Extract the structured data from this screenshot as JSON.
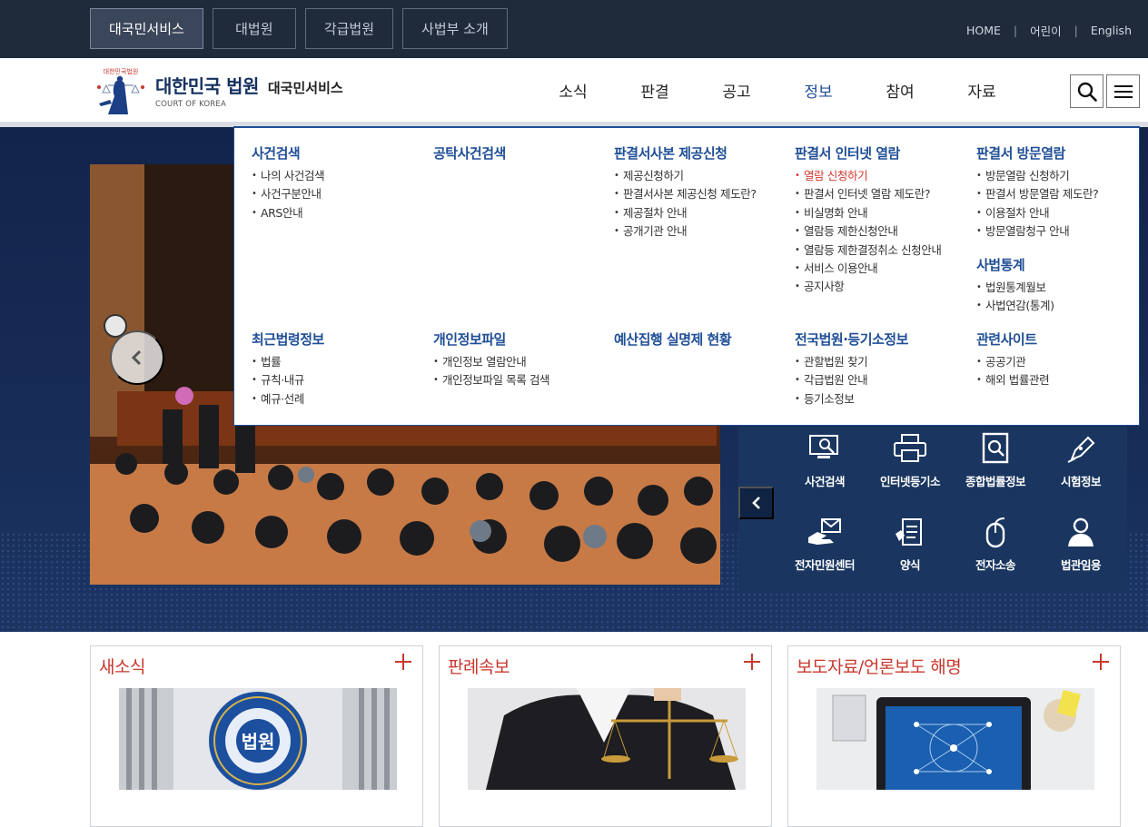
{
  "top_tabs": [
    {
      "label": "대국민서비스",
      "active": true
    },
    {
      "label": "대법원"
    },
    {
      "label": "각급법원"
    },
    {
      "label": "사법부 소개"
    }
  ],
  "utility_links": [
    "HOME",
    "어린이",
    "English"
  ],
  "logo": {
    "title": "대한민국 법원",
    "subtitle": "대국민서비스",
    "english": "COURT OF KOREA",
    "emblem_text": "대한민국법원"
  },
  "gnb": [
    {
      "label": "소식"
    },
    {
      "label": "판결"
    },
    {
      "label": "공고"
    },
    {
      "label": "정보",
      "active": true
    },
    {
      "label": "참여"
    },
    {
      "label": "자료"
    }
  ],
  "header_buttons": {
    "search_icon": "search-icon",
    "menu_icon": "hamburger-menu-icon"
  },
  "mega_menu": {
    "sections": [
      {
        "title": "사건검색",
        "items": [
          "나의 사건검색",
          "사건구분안내",
          "ARS안내"
        ]
      },
      {
        "title": "공탁사건검색",
        "items": []
      },
      {
        "title": "판결서사본 제공신청",
        "items": [
          "제공신청하기",
          "판결서사본 제공신청 제도란?",
          "제공절차 안내",
          "공개기관 안내"
        ]
      },
      {
        "title": "판결서 인터넷 열람",
        "items": [
          "열람 신청하기",
          "판결서 인터넷 열람 제도란?",
          "비실명화 안내",
          "열람등 제한신청안내",
          "열람등 제한결정취소 신청안내",
          "서비스 이용안내",
          "공지사항"
        ],
        "highlight_index": 0
      },
      {
        "title": "판결서 방문열람",
        "items": [
          "방문열람 신청하기",
          "판결서 방문열람 제도란?",
          "이용절차 안내",
          "방문열람청구 안내"
        ]
      },
      {
        "title": "사법통계",
        "items": [
          "법원통계월보",
          "사법연감(통계)"
        ]
      },
      {
        "title": "최근법령정보",
        "items": [
          "법률",
          "규칙·내규",
          "예규·선례"
        ]
      },
      {
        "title": "개인정보파일",
        "items": [
          "개인정보 열람안내",
          "개인정보파일 목록 검색"
        ]
      },
      {
        "title": "예산집행 실명제 현황",
        "items": []
      },
      {
        "title": "전국법원·등기소정보",
        "items": [
          "관할법원 찾기",
          "각급법원 안내",
          "등기소정보"
        ]
      },
      {
        "title": "관련사이트",
        "items": [
          "공공기관",
          "해외 법률관련"
        ]
      }
    ]
  },
  "quick_menu": [
    {
      "label": "사건검색",
      "icon": "monitor-search-icon"
    },
    {
      "label": "인터넷등기소",
      "icon": "printer-icon"
    },
    {
      "label": "종합법률정보",
      "icon": "book-search-icon"
    },
    {
      "label": "시험정보",
      "icon": "pen-icon"
    },
    {
      "label": "전자민원센터",
      "icon": "hand-envelope-icon"
    },
    {
      "label": "양식",
      "icon": "document-icon"
    },
    {
      "label": "전자소송",
      "icon": "mouse-icon"
    },
    {
      "label": "법관임용",
      "icon": "person-icon"
    }
  ],
  "boards": [
    {
      "title": "새소식",
      "image": "court-emblem-building",
      "emblem_label": "법원"
    },
    {
      "title": "판례속보",
      "image": "scales-of-justice"
    },
    {
      "title": "보도자료/언론보도 해명",
      "image": "tablet-network"
    }
  ],
  "colors": {
    "topbar": "#1f2a3b",
    "brand_blue": "#1f4e96",
    "accent_red": "#c8382e",
    "visual_bg": "#172c57",
    "quick_bg": "#1a3660"
  }
}
